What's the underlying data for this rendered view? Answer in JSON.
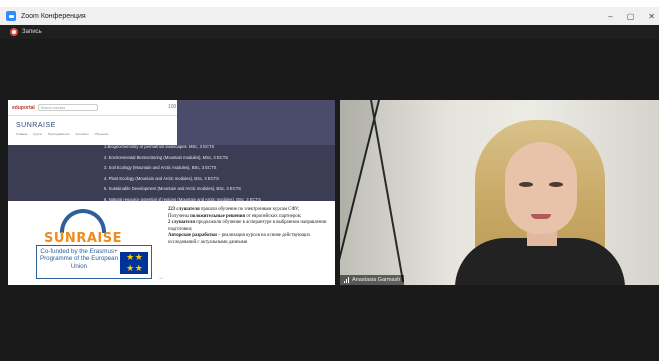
{
  "window": {
    "title": "Zoom Конференция",
    "controls": [
      "–",
      "▢",
      "✕"
    ]
  },
  "recording": {
    "label": "Запись",
    "color": "#e64b3b"
  },
  "shared_screen": {
    "browser": {
      "logo": "eduportal",
      "search_placeholder": "Search courses",
      "site_name": "SUNRAISE",
      "nav": [
        "Главная",
        "Курсы",
        "Преподаватели",
        "Контакты",
        "Обучение"
      ],
      "toolbar": [
        "100",
        "R",
        "★",
        "≡"
      ]
    },
    "courses": [
      "1.Biogeochemistry of permafrost landscapes.  MSc, 3 ECTS",
      "2. Environmental Biomonitoring (Mountain modules), MSc, 3 ECTS",
      "3. Soil Ecology (Mountain and Arctic modules), BSc, 3 ECTS",
      "4. Plant Ecology  (Mountain and Arctic modules), BSc, 3 ECTS",
      "5. Sustainable Development (Mountain and Arctic modules), BSc, 3 ECTS",
      "6. Natural resource potential of regions (Mountain and Arctic modules), BSc, 3 ECTS"
    ],
    "logo_word": "SUNRAISE",
    "erasmus_text": "Co-funded by the Erasmus+ Programme of the European Union",
    "russian_text": [
      {
        "bold": "223 слушателя",
        "rest": " прошли обучение по электронным курсам СФУ;"
      },
      {
        "bold": "",
        "rest": "Получены "
      },
      {
        "bold": "положительные решения",
        "rest": " от европейских партнеров;"
      },
      {
        "bold": "2 слушателя",
        "rest": " продолжили обучение в аспирантуре в выбранном направлении подготовки;"
      },
      {
        "bold": "Авторские разработки",
        "rest": " – реализация курсов на основе действующих исследований с актуальными данными"
      }
    ]
  },
  "participant": {
    "name": "Anastasia Garmash"
  }
}
